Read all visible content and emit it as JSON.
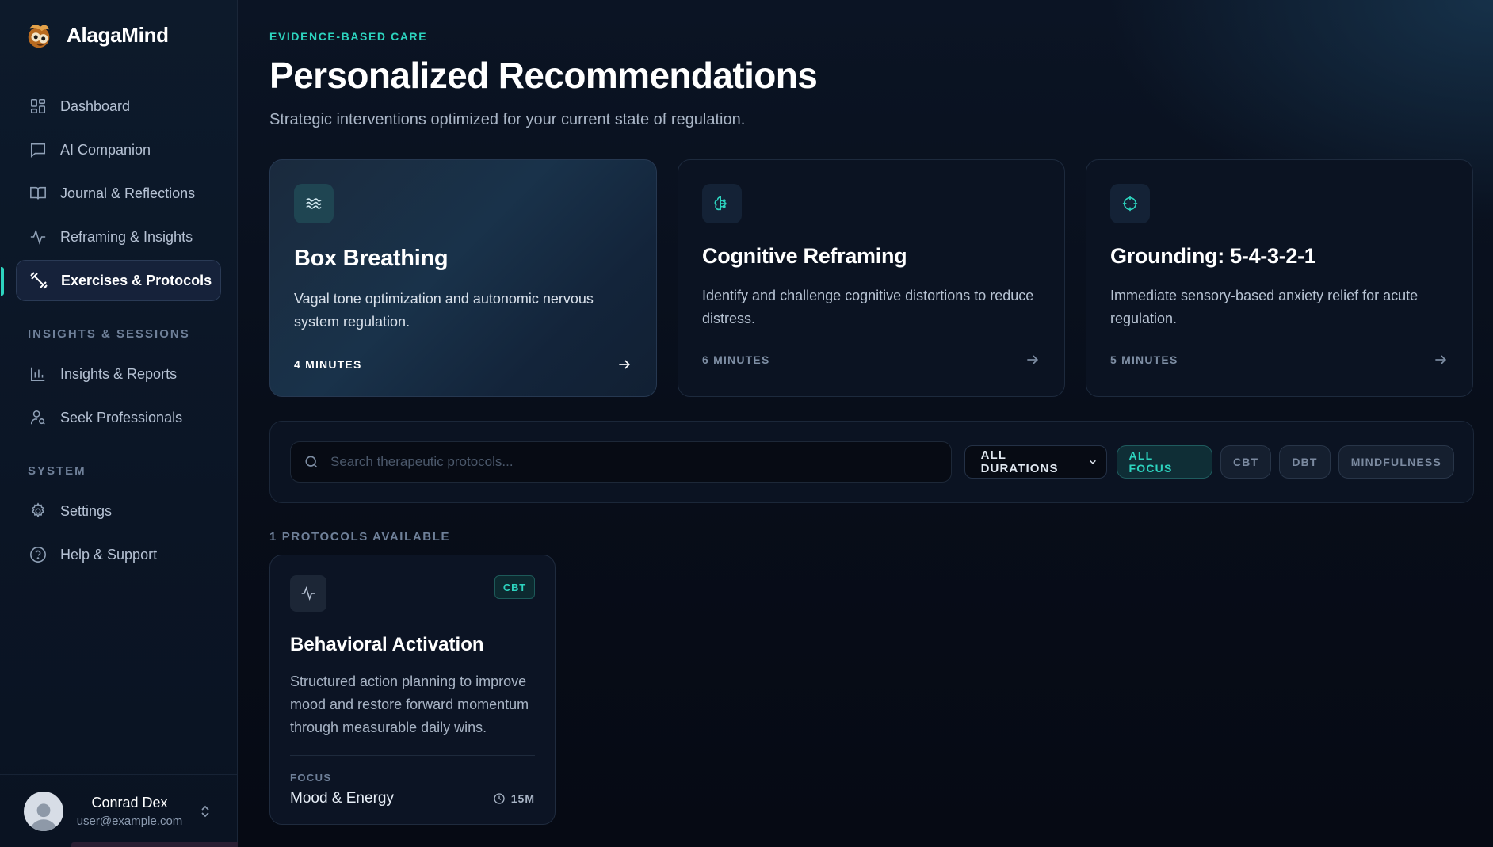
{
  "brand": {
    "name": "AlagaMind"
  },
  "sidebar": {
    "items": [
      {
        "label": "Dashboard",
        "icon": "dashboard-grid-icon"
      },
      {
        "label": "AI Companion",
        "icon": "chat-bubble-icon"
      },
      {
        "label": "Journal & Reflections",
        "icon": "open-book-icon"
      },
      {
        "label": "Reframing & Insights",
        "icon": "activity-pulse-icon"
      },
      {
        "label": "Exercises & Protocols",
        "icon": "dumbbell-icon",
        "active": true
      }
    ],
    "section_insights": "INSIGHTS & SESSIONS",
    "insights_items": [
      {
        "label": "Insights & Reports",
        "icon": "bar-chart-icon"
      },
      {
        "label": "Seek Professionals",
        "icon": "user-search-icon"
      }
    ],
    "section_system": "SYSTEM",
    "system_items": [
      {
        "label": "Settings",
        "icon": "gear-icon"
      },
      {
        "label": "Help & Support",
        "icon": "help-circle-icon"
      }
    ]
  },
  "user": {
    "name": "Conrad Dex",
    "email": "user@example.com"
  },
  "header": {
    "eyebrow": "EVIDENCE-BASED CARE",
    "title": "Personalized Recommendations",
    "subtitle": "Strategic interventions optimized for your current state of regulation."
  },
  "recommendations": [
    {
      "title": "Box Breathing",
      "description": "Vagal tone optimization and autonomic nervous system regulation.",
      "duration": "4 MINUTES",
      "icon": "waves-icon"
    },
    {
      "title": "Cognitive Reframing",
      "description": "Identify and challenge cognitive distortions to reduce distress.",
      "duration": "6 MINUTES",
      "icon": "brain-icon"
    },
    {
      "title": "Grounding: 5-4-3-2-1",
      "description": "Immediate sensory-based anxiety relief for acute regulation.",
      "duration": "5 MINUTES",
      "icon": "crosshair-icon"
    }
  ],
  "filters": {
    "search_placeholder": "Search therapeutic protocols...",
    "duration_select": "ALL DURATIONS",
    "chips": [
      "ALL FOCUS",
      "CBT",
      "DBT",
      "MINDFULNESS"
    ],
    "active_chip": "ALL FOCUS"
  },
  "results": {
    "count_label": "1 PROTOCOLS AVAILABLE",
    "protocols": [
      {
        "title": "Behavioral Activation",
        "badge": "CBT",
        "description": "Structured action planning to improve mood and restore forward momentum through measurable daily wins.",
        "focus_label": "FOCUS",
        "focus": "Mood & Energy",
        "time": "15M",
        "icon": "activity-pulse-icon"
      }
    ]
  },
  "colors": {
    "accent": "#2dd4bf",
    "background": "#070c17",
    "sidebar": "#0d1a2b"
  }
}
